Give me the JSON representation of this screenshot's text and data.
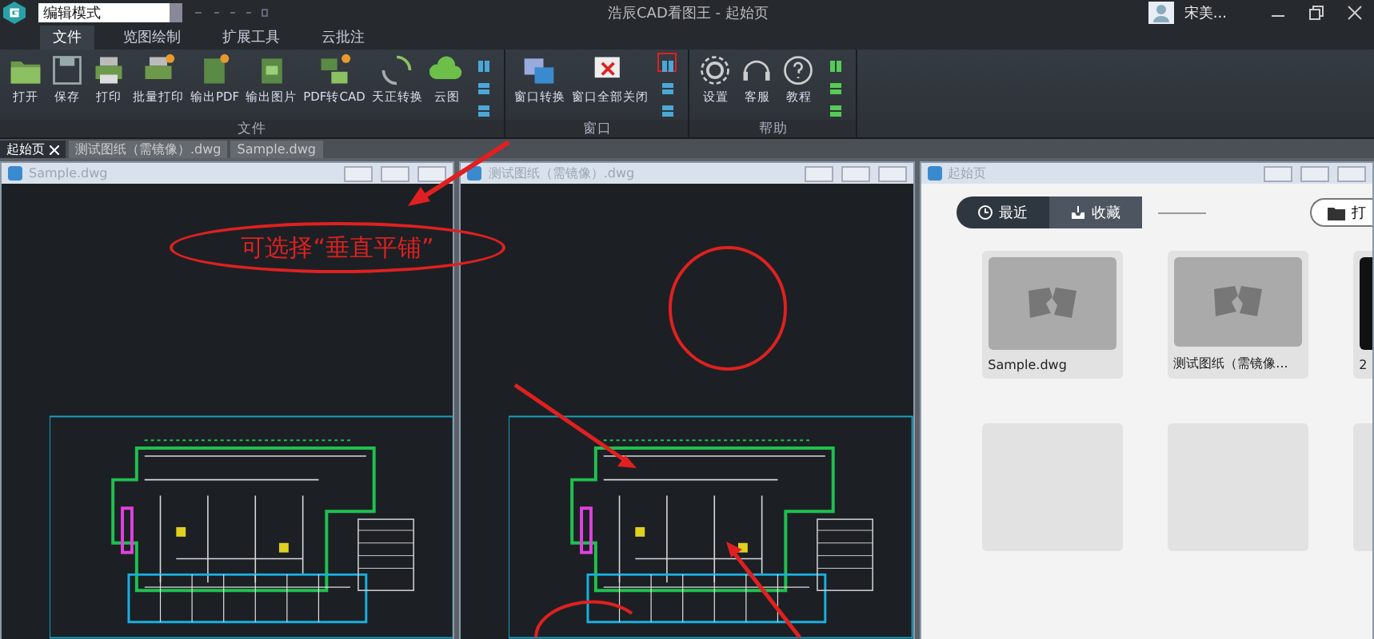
{
  "window": {
    "title": "浩辰CAD看图王 - 起始页",
    "mode": "编辑模式",
    "user": "宋美..."
  },
  "ribbon_tabs": [
    {
      "label": "文件",
      "selected": true
    },
    {
      "label": "览图绘制",
      "selected": false
    },
    {
      "label": "扩展工具",
      "selected": false
    },
    {
      "label": "云批注",
      "selected": false
    }
  ],
  "ribbon_groups": [
    {
      "label": "文件",
      "buttons": [
        "打开",
        "保存",
        "打印",
        "批量打印",
        "输出PDF",
        "输出图片",
        "PDF转CAD",
        "天正转换",
        "云图"
      ],
      "small_buttons": [
        {
          "highlighted": false
        },
        {
          "highlighted": false
        },
        {
          "highlighted": false
        }
      ]
    },
    {
      "label": "窗口",
      "buttons": [
        "窗口转换",
        "窗口全部关闭"
      ],
      "small_buttons": [
        {
          "highlighted": true
        },
        {
          "highlighted": false
        },
        {
          "highlighted": false
        }
      ]
    },
    {
      "label": "帮助",
      "buttons": [
        "设置",
        "客服",
        "教程"
      ],
      "small_buttons": [
        {
          "highlighted": false
        },
        {
          "highlighted": false
        },
        {
          "highlighted": false
        }
      ]
    }
  ],
  "doc_tabs": [
    {
      "label": "起始页",
      "selected": true
    },
    {
      "label": "测试图纸（需镜像）.dwg",
      "selected": false
    },
    {
      "label": "Sample.dwg",
      "selected": false
    }
  ],
  "child_windows": [
    {
      "title": "Sample.dwg",
      "kind": "drawing"
    },
    {
      "title": "测试图纸（需镜像）.dwg",
      "kind": "drawing"
    },
    {
      "title": "起始页",
      "kind": "start"
    }
  ],
  "start_page": {
    "tabs": [
      {
        "label": "最近",
        "selected": true
      },
      {
        "label": "收藏",
        "selected": false
      }
    ],
    "open_button": "打",
    "files": [
      {
        "name": "Sample.dwg",
        "kind": "thumb"
      },
      {
        "name": "测试图纸（需镜像...",
        "kind": "thumb"
      },
      {
        "name": "2",
        "kind": "dark"
      },
      {
        "kind": "empty"
      },
      {
        "kind": "empty"
      },
      {
        "kind": "empty"
      }
    ]
  },
  "annotation": {
    "callout": "可选择“垂直平铺”"
  }
}
